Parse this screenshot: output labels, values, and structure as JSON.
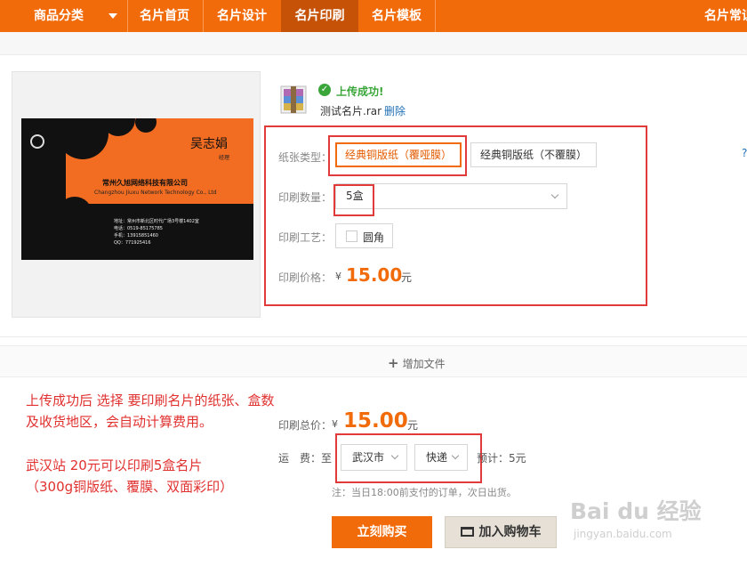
{
  "nav": {
    "category": "商品分类",
    "items": [
      "名片首页",
      "名片设计",
      "名片印刷",
      "名片模板",
      "名片常识"
    ],
    "active_index": 2
  },
  "preview": {
    "card_name": "吴志娟",
    "card_title": "经理",
    "company": "常州久旭网络科技有限公司",
    "company_en": "Changzhou Jiuxu Network Technology Co., Ltd",
    "address": "地址：常州市新北区时代广场3号楼1402室",
    "phone": "电话：0519-85175785",
    "mobile": "手机：13915851460",
    "qq": "QQ：771925416"
  },
  "upload": {
    "status": "上传成功!",
    "file_name": "测试名片.rar",
    "delete_label": "删除"
  },
  "options": {
    "paper_label": "纸张类型：",
    "paper_options": [
      "经典铜版纸（覆哑膜）",
      "经典铜版纸（不覆膜）"
    ],
    "paper_selected": 0,
    "qty_label": "印刷数量：",
    "qty_value": "5盒",
    "craft_label": "印刷工艺：",
    "craft_option": "圆角",
    "price_label": "印刷价格：",
    "price_currency": "¥",
    "price_value": "15.00",
    "price_unit": "元"
  },
  "add_file": "增加文件",
  "annotation": {
    "line1": "上传成功后 选择 要印刷名片的纸张、盒数",
    "line2": "及收货地区，会自动计算费用。",
    "line3": "武汉站 20元可以印刷5盒名片",
    "line4": "（300g铜版纸、覆膜、双面彩印）"
  },
  "order": {
    "total_label": "印刷总价：",
    "total_currency": "¥",
    "total_value": "15.00",
    "total_unit": "元",
    "shipping_label": "运　费：至",
    "city": "武汉市",
    "method": "快递",
    "estimate": "预计：5元",
    "hint": "注：当日18:00前支付的订单，次日出货。",
    "buy_label": "立刻购买",
    "cart_label": "加入购物车"
  },
  "watermark": {
    "main": "Bai du 经验",
    "sub": "jingyan.baidu.com"
  },
  "colors": {
    "brand_orange": "#f26b0a",
    "annotation_red": "#e0312f",
    "success_green": "#3aa63a",
    "link_blue": "#1f6fb5"
  }
}
